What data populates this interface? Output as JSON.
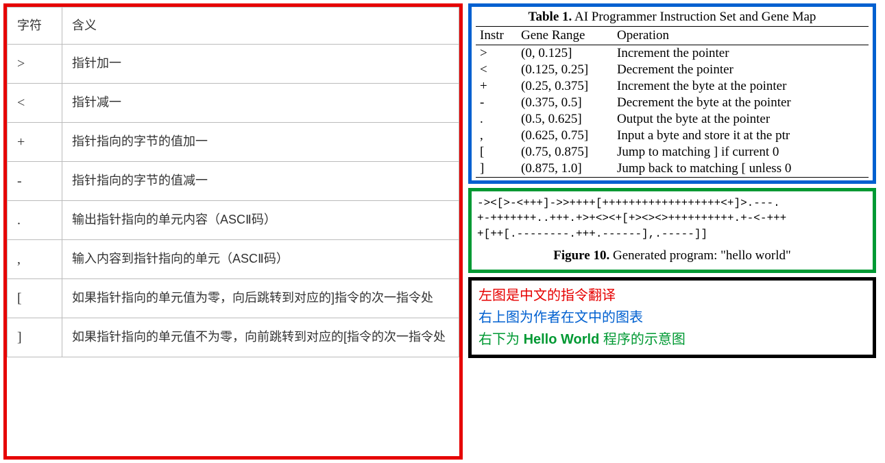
{
  "left_table": {
    "header": {
      "col1": "字符",
      "col2": "含义"
    },
    "rows": [
      {
        "sym": ">",
        "meaning": "指针加一"
      },
      {
        "sym": "<",
        "meaning": "指针减一"
      },
      {
        "sym": "+",
        "meaning": "指针指向的字节的值加一"
      },
      {
        "sym": "-",
        "meaning": "指针指向的字节的值减一"
      },
      {
        "sym": ".",
        "meaning": "输出指针指向的单元内容（ASCⅡ码）"
      },
      {
        "sym": ",",
        "meaning": "输入内容到指针指向的单元（ASCⅡ码）"
      },
      {
        "sym": "[",
        "meaning": "如果指针指向的单元值为零，向后跳转到对应的]指令的次一指令处"
      },
      {
        "sym": "]",
        "meaning": "如果指针指向的单元值不为零，向前跳转到对应的[指令的次一指令处"
      }
    ]
  },
  "blue_panel": {
    "title_bold": "Table 1.",
    "title_rest": "  AI Programmer Instruction Set and Gene Map",
    "header": {
      "c1": "Instr",
      "c2": "Gene Range",
      "c3": "Operation"
    },
    "rows": [
      {
        "instr": ">",
        "range": "(0, 0.125]",
        "op": "Increment the pointer"
      },
      {
        "instr": "<",
        "range": "(0.125, 0.25]",
        "op": "Decrement the pointer"
      },
      {
        "instr": "+",
        "range": "(0.25, 0.375]",
        "op": "Increment the byte at the pointer"
      },
      {
        "instr": "-",
        "range": "(0.375, 0.5]",
        "op": "Decrement the byte at the pointer"
      },
      {
        "instr": ".",
        "range": "(0.5, 0.625]",
        "op": "Output the byte at the pointer"
      },
      {
        "instr": ",",
        "range": "(0.625, 0.75]",
        "op": "Input a byte and store it at the ptr"
      },
      {
        "instr": "[",
        "range": "(0.75, 0.875]",
        "op": "Jump to matching ] if current 0"
      },
      {
        "instr": "]",
        "range": "(0.875, 1.0]",
        "op": "Jump back to matching [ unless 0"
      }
    ]
  },
  "green_panel": {
    "code_line1": "-><[>-<+++]->>++++[++++++++++++++++++<+]>.---.",
    "code_line2": "+-+++++++..+++.+>+<><+[+><><>++++++++++.+-<-+++",
    "code_line3": "+[++[.--------.+++.------],.-----]]",
    "caption_bold": "Figure 10.",
    "caption_rest": "  Generated program: \"hello world\""
  },
  "black_panel": {
    "line1": "左图是中文的指令翻译",
    "line2": "右上图为作者在文中的图表",
    "line3_prefix": "右下为 ",
    "line3_bold": "Hello World",
    "line3_suffix": " 程序的示意图"
  }
}
